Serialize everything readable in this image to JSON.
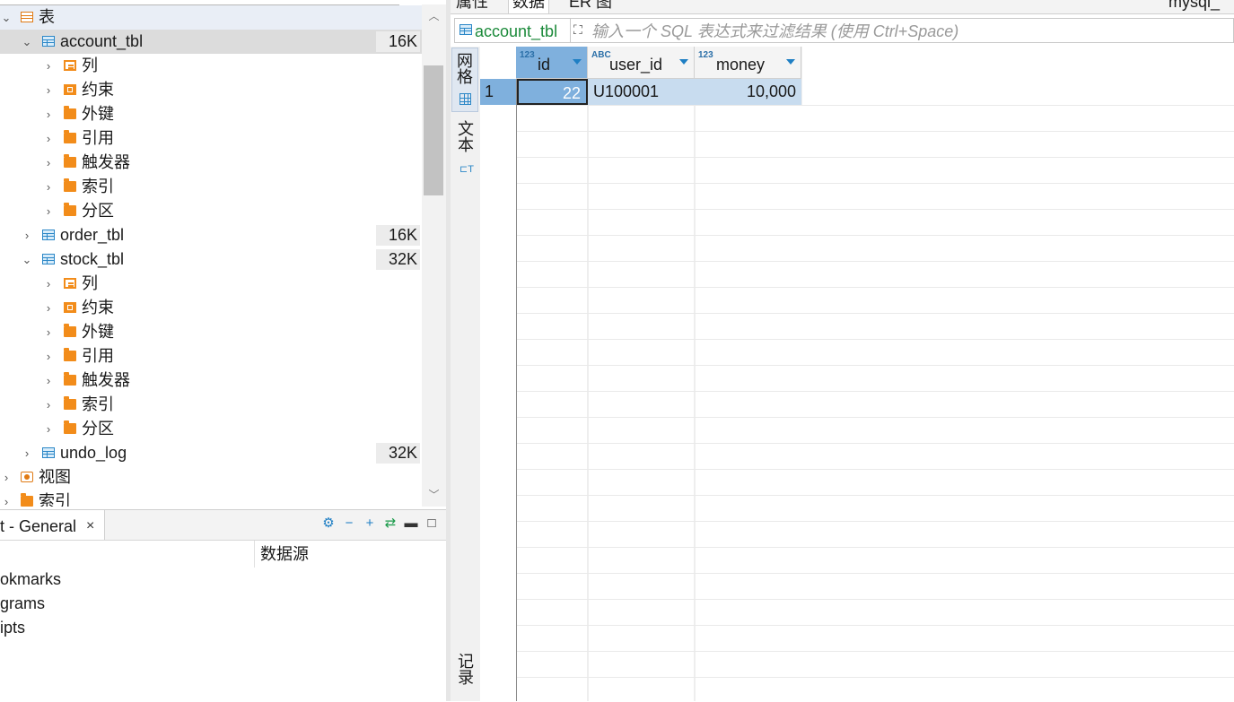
{
  "navigator": {
    "tables_label": "表",
    "tables": [
      {
        "name": "account_tbl",
        "size": "16K",
        "children": [
          "列",
          "约束",
          "外键",
          "引用",
          "触发器",
          "索引",
          "分区"
        ]
      },
      {
        "name": "order_tbl",
        "size": "16K"
      },
      {
        "name": "stock_tbl",
        "size": "32K",
        "children": [
          "列",
          "约束",
          "外键",
          "引用",
          "触发器",
          "索引",
          "分区"
        ]
      },
      {
        "name": "undo_log",
        "size": "32K"
      }
    ],
    "views_label": "视图",
    "indexes_label": "索引"
  },
  "project_panel": {
    "tab_label": "t - General",
    "close_symbol": "×",
    "column_datasource": "数据源",
    "items": [
      "okmarks",
      "grams",
      "ipts"
    ]
  },
  "editor": {
    "tabs": [
      "属性",
      "数据",
      "ER 图"
    ],
    "connection_tab": "mysql_",
    "filter_table": "account_tbl",
    "filter_placeholder": "输入一个 SQL 表达式来过滤结果 (使用 Ctrl+Space)",
    "view_grid_label": "网格",
    "view_text_label": "文本",
    "records_label": "记录"
  },
  "result_grid": {
    "columns": [
      {
        "name": "id",
        "type": "123"
      },
      {
        "name": "user_id",
        "type": "ABC"
      },
      {
        "name": "money",
        "type": "123"
      }
    ],
    "rows": [
      {
        "row_number": "1",
        "id": "22",
        "user_id": "U100001",
        "money": "10,000"
      }
    ]
  },
  "colors": {
    "folder_orange": "#f28c1a",
    "table_blue": "#2b87c7",
    "selection_blue": "#7fb0dd",
    "filter_table_green": "#1b8a3a"
  }
}
